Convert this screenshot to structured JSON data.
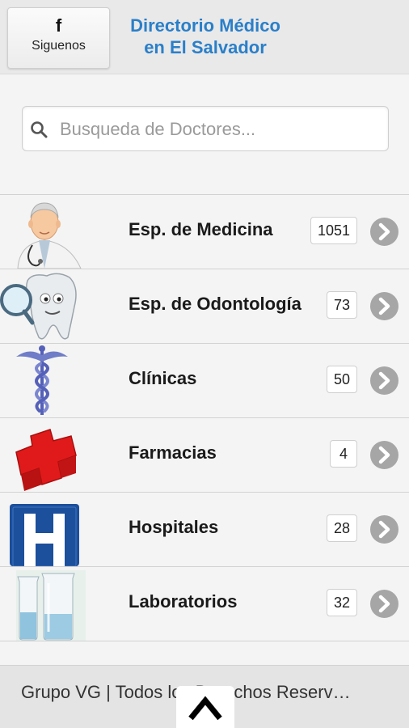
{
  "header": {
    "facebook_icon": "f",
    "facebook_label": "Siguenos",
    "title_line1": "Directorio Médico",
    "title_line2": "en El Salvador"
  },
  "search": {
    "placeholder": "Busqueda de Doctores..."
  },
  "categories": [
    {
      "label": "Esp. de Medicina",
      "count": "1051",
      "icon": "doctor-icon"
    },
    {
      "label": "Esp. de Odontología",
      "count": "73",
      "icon": "tooth-icon"
    },
    {
      "label": "Clínicas",
      "count": "50",
      "icon": "caduceus-icon"
    },
    {
      "label": "Farmacias",
      "count": "4",
      "icon": "red-cross-icon"
    },
    {
      "label": "Hospitales",
      "count": "28",
      "icon": "hospital-sign-icon"
    },
    {
      "label": "Laboratorios",
      "count": "32",
      "icon": "beakers-icon"
    }
  ],
  "footer": {
    "text": "Grupo VG | Todos los Derechos Reserv…"
  },
  "colors": {
    "title_blue": "#2a7fc9",
    "arrow_gray": "#a6a6a6",
    "cross_red": "#e01a1a",
    "hospital_blue": "#1c4f9c"
  }
}
